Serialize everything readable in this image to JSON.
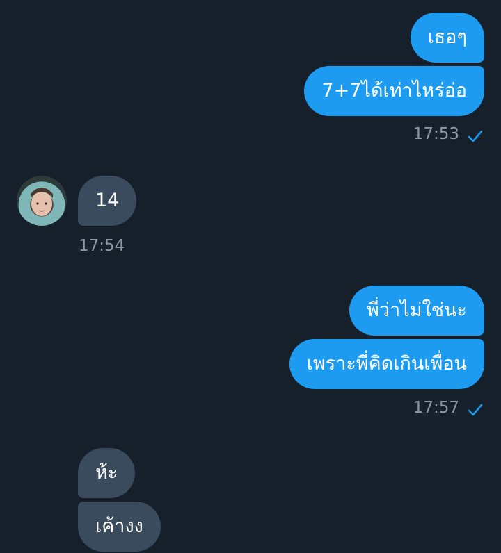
{
  "conversation": {
    "group1_outgoing": {
      "messages": [
        "เธอๆ",
        "7+7ได้เท่าไหร่อ่อ"
      ],
      "time": "17:53"
    },
    "group2_incoming": {
      "messages": [
        "14"
      ],
      "time": "17:54"
    },
    "group3_outgoing": {
      "messages": [
        "พี่ว่าไม่ใช่นะ",
        "เพราะพี่คิดเกินเพื่อน"
      ],
      "time": "17:57"
    },
    "group4_incoming": {
      "messages": [
        "ห้ะ",
        "เค้างง"
      ]
    }
  },
  "icons": {
    "read_receipt": "check-icon",
    "avatar": "contact-avatar"
  },
  "colors": {
    "background": "#16202b",
    "outgoing_bubble": "#1d9bf0",
    "incoming_bubble": "#3b4b5e",
    "timestamp": "#8b98a5",
    "check": "#1d9bf0"
  }
}
